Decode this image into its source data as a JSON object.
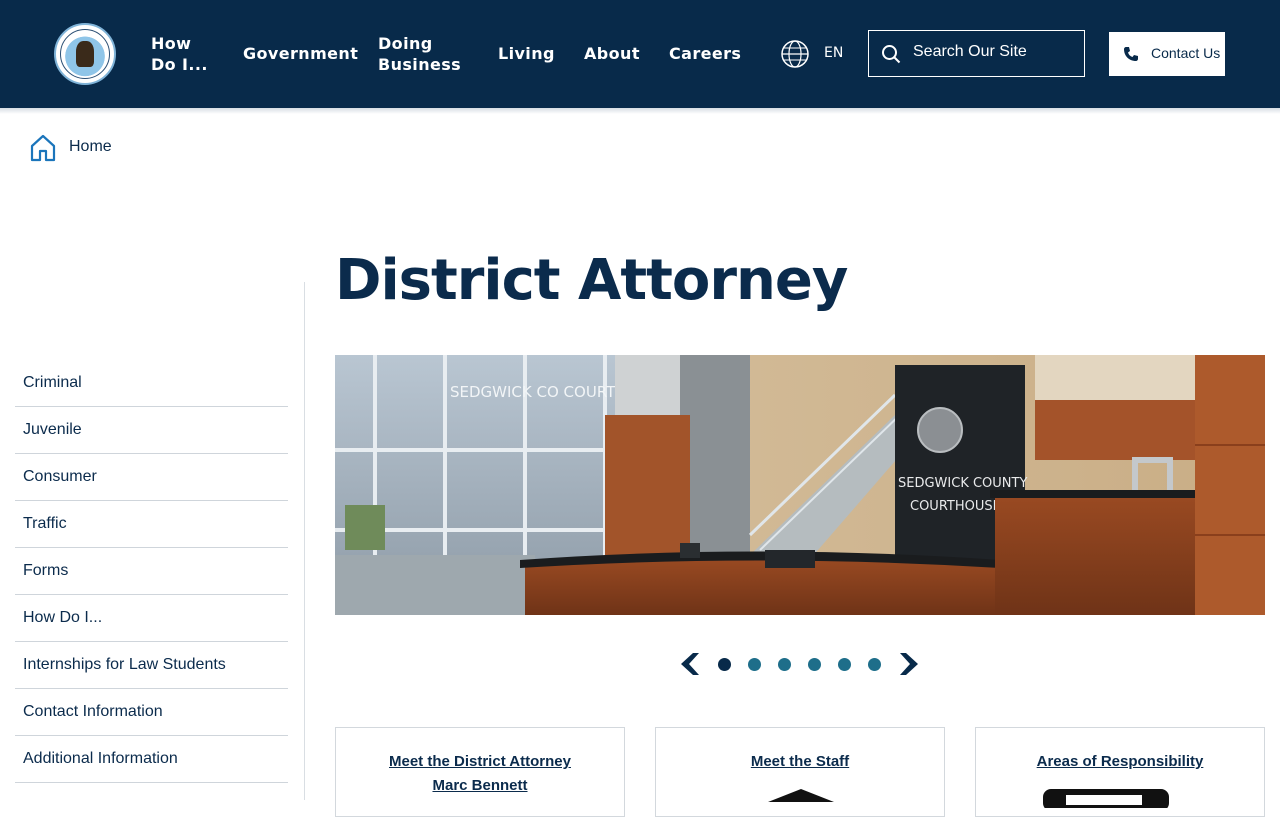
{
  "header": {
    "logo_text": "SEDGWICK COUNTY KANSAS",
    "nav": [
      {
        "label": "How Do I..."
      },
      {
        "label": "Government"
      },
      {
        "label": "Doing Business"
      },
      {
        "label": "Living"
      },
      {
        "label": "About"
      },
      {
        "label": "Careers"
      }
    ],
    "language": "EN",
    "search_placeholder": "Search Our Site",
    "contact_label": "Contact Us"
  },
  "breadcrumb": {
    "home_label": "Home"
  },
  "page_title": "District Attorney",
  "sidebar": {
    "items": [
      {
        "label": "Criminal"
      },
      {
        "label": "Juvenile"
      },
      {
        "label": "Consumer"
      },
      {
        "label": "Traffic"
      },
      {
        "label": "Forms"
      },
      {
        "label": "How Do I..."
      },
      {
        "label": "Internships for Law Students"
      },
      {
        "label": "Contact Information"
      },
      {
        "label": "Additional Information"
      }
    ]
  },
  "hero": {
    "sign_line1": "SEDGWICK COUNTY",
    "sign_line2": "COURTHOUSE",
    "glass_text": "SEDGWICK CO COURTHOUSE",
    "slide_count": 6,
    "active_slide": 1
  },
  "cards": [
    {
      "title_line1": "Meet the District Attorney",
      "title_line2": "Marc Bennett"
    },
    {
      "title_line1": "Meet the Staff",
      "title_line2": ""
    },
    {
      "title_line1": "Areas of Responsibility",
      "title_line2": ""
    }
  ],
  "colors": {
    "brand_navy": "#082a4a",
    "accent_blue": "#1e6e8a",
    "link_blue": "#1b75bb"
  }
}
